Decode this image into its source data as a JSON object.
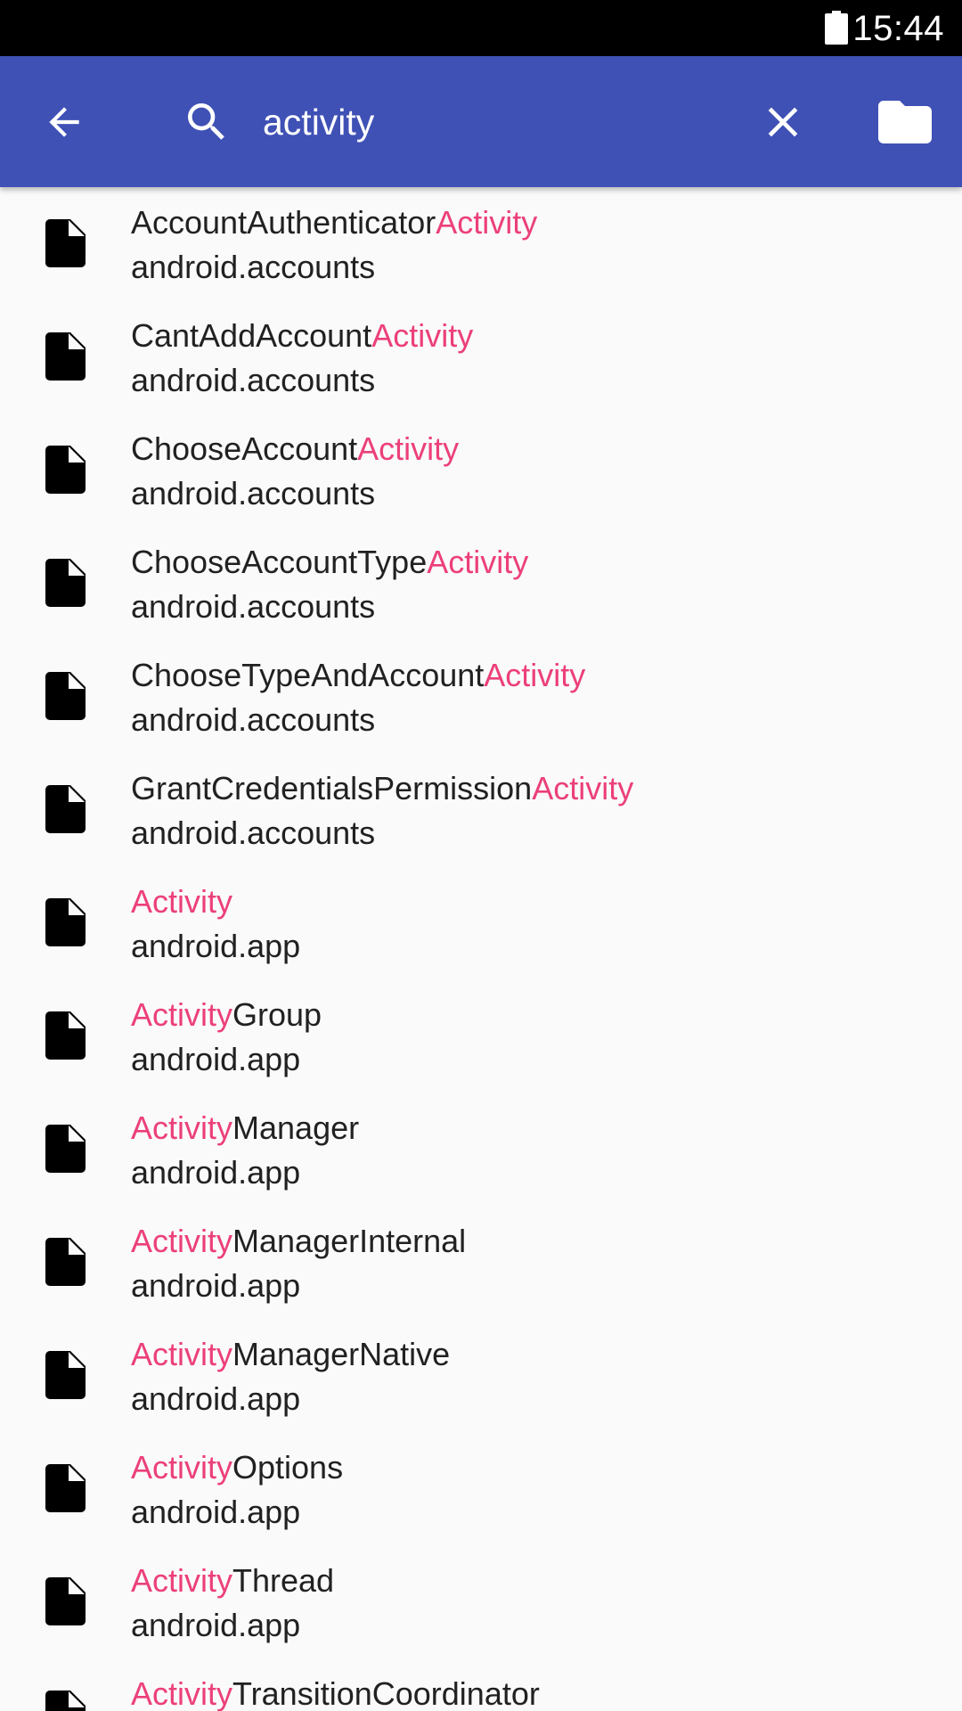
{
  "status_bar": {
    "time": "15:44",
    "battery_icon": "battery-full-icon"
  },
  "toolbar": {
    "background": "#3f51b5",
    "back_icon": "arrow-left-icon",
    "search_icon": "search-icon",
    "search_value": "activity",
    "clear_icon": "close-icon",
    "folder_icon": "folder-icon"
  },
  "highlight_color": "#ec407a",
  "results": [
    {
      "prefix": "AccountAuthenticator",
      "match": "Activity",
      "suffix": "",
      "package": "android.accounts"
    },
    {
      "prefix": "CantAddAccount",
      "match": "Activity",
      "suffix": "",
      "package": "android.accounts"
    },
    {
      "prefix": "ChooseAccount",
      "match": "Activity",
      "suffix": "",
      "package": "android.accounts"
    },
    {
      "prefix": "ChooseAccountType",
      "match": "Activity",
      "suffix": "",
      "package": "android.accounts"
    },
    {
      "prefix": "ChooseTypeAndAccount",
      "match": "Activity",
      "suffix": "",
      "package": "android.accounts"
    },
    {
      "prefix": "GrantCredentialsPermission",
      "match": "Activity",
      "suffix": "",
      "package": "android.accounts"
    },
    {
      "prefix": "",
      "match": "Activity",
      "suffix": "",
      "package": "android.app"
    },
    {
      "prefix": "",
      "match": "Activity",
      "suffix": "Group",
      "package": "android.app"
    },
    {
      "prefix": "",
      "match": "Activity",
      "suffix": "Manager",
      "package": "android.app"
    },
    {
      "prefix": "",
      "match": "Activity",
      "suffix": "ManagerInternal",
      "package": "android.app"
    },
    {
      "prefix": "",
      "match": "Activity",
      "suffix": "ManagerNative",
      "package": "android.app"
    },
    {
      "prefix": "",
      "match": "Activity",
      "suffix": "Options",
      "package": "android.app"
    },
    {
      "prefix": "",
      "match": "Activity",
      "suffix": "Thread",
      "package": "android.app"
    },
    {
      "prefix": "",
      "match": "Activity",
      "suffix": "TransitionCoordinator",
      "package": ""
    }
  ]
}
